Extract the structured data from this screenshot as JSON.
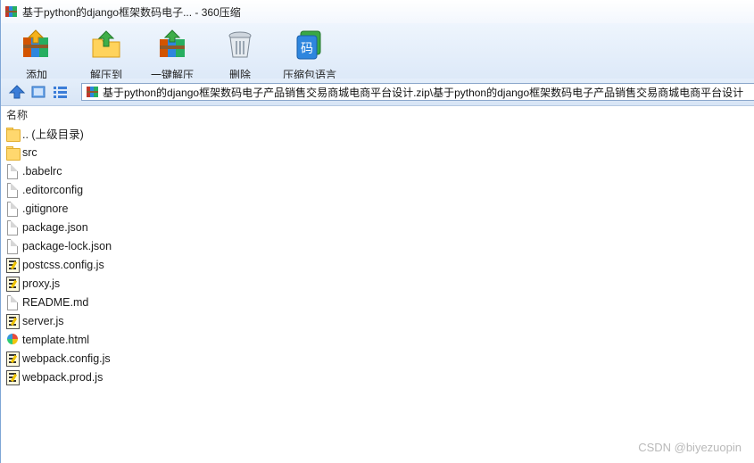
{
  "window": {
    "title": "基于python的django框架数码电子... - 360压缩"
  },
  "toolbar": {
    "buttons": [
      {
        "label": "添加",
        "icon": "add-archive-icon"
      },
      {
        "label": "解压到",
        "icon": "extract-to-icon"
      },
      {
        "label": "一键解压",
        "icon": "one-click-extract-icon"
      },
      {
        "label": "删除",
        "icon": "delete-trash-icon"
      },
      {
        "label": "压缩包语言",
        "icon": "archive-language-icon"
      }
    ],
    "lang_glyph": "码"
  },
  "address": {
    "path": "基于python的django框架数码电子产品销售交易商城电商平台设计.zip\\基于python的django框架数码电子产品销售交易商城电商平台设计"
  },
  "list": {
    "column_name": "名称",
    "files": [
      {
        "name": ".. (上级目录)",
        "type": "folder"
      },
      {
        "name": "src",
        "type": "folder"
      },
      {
        "name": ".babelrc",
        "type": "file"
      },
      {
        "name": ".editorconfig",
        "type": "file"
      },
      {
        "name": ".gitignore",
        "type": "file"
      },
      {
        "name": "package.json",
        "type": "file"
      },
      {
        "name": "package-lock.json",
        "type": "file"
      },
      {
        "name": "postcss.config.js",
        "type": "js"
      },
      {
        "name": "proxy.js",
        "type": "js"
      },
      {
        "name": "README.md",
        "type": "file"
      },
      {
        "name": "server.js",
        "type": "js"
      },
      {
        "name": "template.html",
        "type": "html"
      },
      {
        "name": "webpack.config.js",
        "type": "js"
      },
      {
        "name": "webpack.prod.js",
        "type": "js"
      }
    ]
  },
  "watermark": "CSDN @biyezuopin",
  "colors": {
    "accent": "#3b7dd8",
    "toolbar_bg": "#e4eefa",
    "folder": "#ffd86e"
  }
}
